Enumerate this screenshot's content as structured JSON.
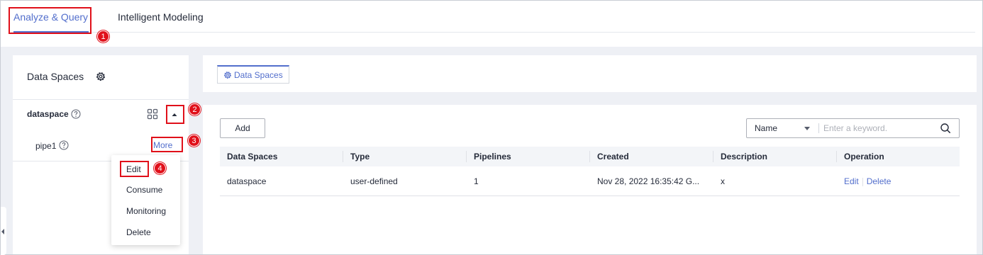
{
  "top_tabs": [
    {
      "label": "Analyze & Query",
      "active": true
    },
    {
      "label": "Intelligent Modeling",
      "active": false
    }
  ],
  "annotations": [
    "1",
    "2",
    "3",
    "4"
  ],
  "left_panel": {
    "title": "Data Spaces",
    "icon": "gear-icon",
    "dataspace": {
      "name": "dataspace",
      "help_icon": "question-circle-icon"
    },
    "pipe": {
      "name": "pipe1",
      "help_icon": "question-circle-icon",
      "more_label": "More"
    },
    "menu": [
      "Edit",
      "Consume",
      "Monitoring",
      "Delete"
    ]
  },
  "breadcrumb": {
    "label": "Data Spaces",
    "icon": "gear-icon"
  },
  "toolbar": {
    "add_label": "Add",
    "search_field": "Name",
    "search_placeholder": "Enter a keyword."
  },
  "table": {
    "columns": [
      "Data Spaces",
      "Type",
      "Pipelines",
      "Created",
      "Description",
      "Operation"
    ],
    "rows": [
      {
        "data_space": "dataspace",
        "type": "user-defined",
        "pipelines": "1",
        "created": "Nov 28, 2022 16:35:42 G...",
        "description": "x",
        "operations": [
          "Edit",
          "Delete"
        ]
      }
    ]
  },
  "colors": {
    "accent": "#526ecc",
    "annotation": "#e0101a",
    "page_bg": "#eef0f5"
  }
}
